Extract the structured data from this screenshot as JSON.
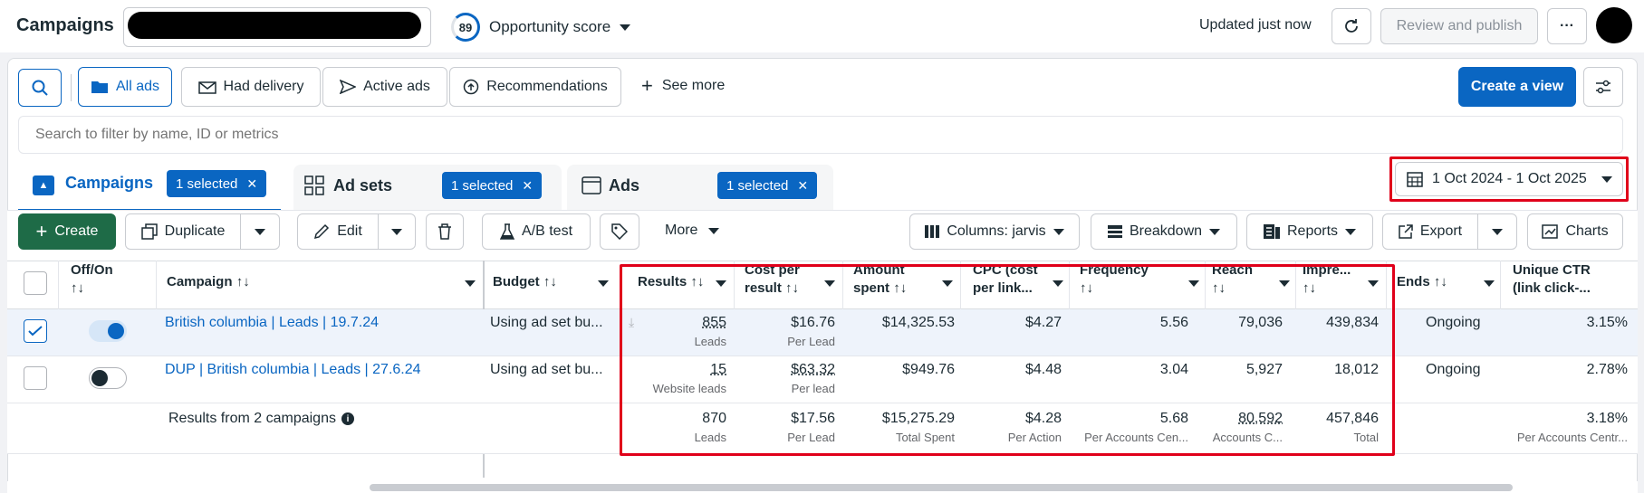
{
  "header": {
    "title": "Campaigns",
    "opportunity_score": "89",
    "opportunity_label": "Opportunity score",
    "updated": "Updated just now",
    "review_publish": "Review and publish",
    "more_dots": "···"
  },
  "filters": {
    "all_ads": "All ads",
    "had_delivery": "Had delivery",
    "active_ads": "Active ads",
    "recommendations": "Recommendations",
    "see_more": "See more",
    "create_view": "Create a view",
    "search_placeholder": "Search to filter by name, ID or metrics"
  },
  "tabs": {
    "campaigns": "Campaigns",
    "ad_sets": "Ad sets",
    "ads": "Ads",
    "selected": "1 selected",
    "close": "✕"
  },
  "date_range": "1 Oct 2024 - 1 Oct 2025",
  "toolbar": {
    "create": "Create",
    "duplicate": "Duplicate",
    "edit": "Edit",
    "ab_test": "A/B test",
    "more": "More",
    "columns": "Columns: jarvis",
    "breakdown": "Breakdown",
    "reports": "Reports",
    "export": "Export",
    "charts": "Charts"
  },
  "columns": {
    "off_on": "Off/On",
    "campaign": "Campaign",
    "budget": "Budget",
    "results": "Results",
    "cost_per_result_1": "Cost per",
    "cost_per_result_2": "result",
    "amount_spent_1": "Amount",
    "amount_spent_2": "spent",
    "cpc_1": "CPC (cost",
    "cpc_2": "per link...",
    "frequency": "Frequency",
    "reach": "Reach",
    "impressions": "Impre...",
    "ends": "Ends",
    "unique_ctr_1": "Unique CTR",
    "unique_ctr_2": "(link click-...",
    "sort": "↑↓"
  },
  "rows": [
    {
      "campaign": "British columbia | Leads | 19.7.24",
      "budget": "Using ad set bu...",
      "results": "855",
      "results_sub": "Leads",
      "cost_per_result": "$16.76",
      "cost_sub": "Per Lead",
      "amount_spent": "$14,325.53",
      "cpc": "$4.27",
      "frequency": "5.56",
      "reach": "79,036",
      "impressions": "439,834",
      "ends": "Ongoing",
      "unique_ctr": "3.15%"
    },
    {
      "campaign": "DUP | British columbia | Leads | 27.6.24",
      "budget": "Using ad set bu...",
      "results": "15",
      "results_sub": "Website leads",
      "cost_per_result": "$63.32",
      "cost_sub": "Per lead",
      "amount_spent": "$949.76",
      "cpc": "$4.48",
      "frequency": "3.04",
      "reach": "5,927",
      "impressions": "18,012",
      "ends": "Ongoing",
      "unique_ctr": "2.78%"
    }
  ],
  "totals": {
    "label": "Results from 2 campaigns",
    "results": "870",
    "results_sub": "Leads",
    "cost_per_result": "$17.56",
    "cost_sub": "Per Lead",
    "amount_spent": "$15,275.29",
    "amount_sub": "Total Spent",
    "cpc": "$4.28",
    "cpc_sub": "Per Action",
    "frequency": "5.68",
    "frequency_sub": "Per Accounts Cen...",
    "reach": "80,592",
    "reach_sub": "Accounts C...",
    "impressions": "457,846",
    "impressions_sub": "Total",
    "unique_ctr": "3.18%",
    "unique_ctr_sub": "Per Accounts Centr..."
  },
  "colors": {
    "accent": "#0a66c2",
    "create_green": "#1e6b47",
    "highlight_red": "#e0001a"
  }
}
